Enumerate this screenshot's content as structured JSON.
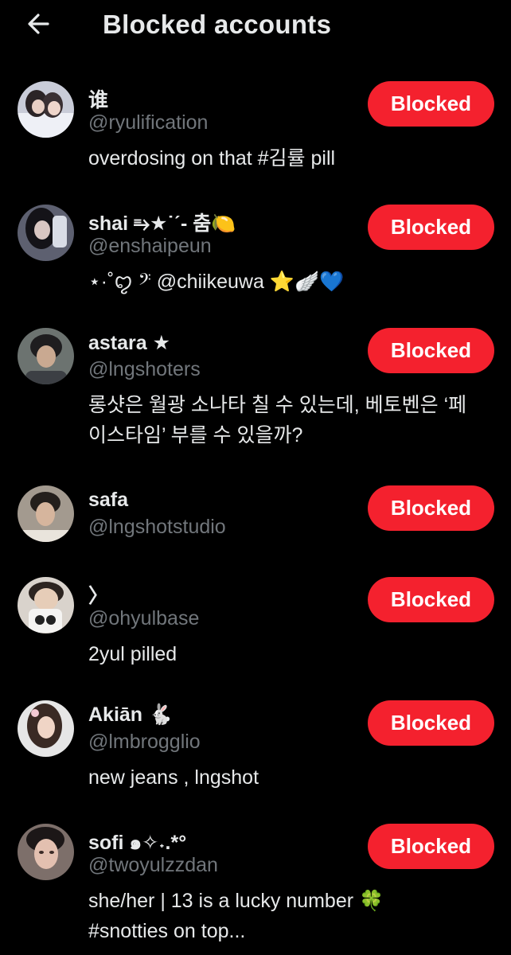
{
  "header": {
    "title": "Blocked accounts",
    "back_icon": "arrow-left-icon"
  },
  "colors": {
    "background": "#000000",
    "primary_text": "#e7e9ea",
    "secondary_text": "#71767b",
    "blocked_button": "#f4212e"
  },
  "accounts": [
    {
      "name": "谁",
      "handle": "@ryulification",
      "bio": [
        "overdosing on that #김률 pill"
      ],
      "button": "Blocked"
    },
    {
      "name": "shai ⥱★˙ˊ- 춤🍋",
      "handle": "@enshaipeun",
      "bio": [
        "⋆·˚ꨄ︎ 𝄢 @chiikeuwa ⭐🪽💙"
      ],
      "button": "Blocked"
    },
    {
      "name": "astara ★",
      "handle": "@lngshoters",
      "bio": [
        "롱샷은 월광 소나타 칠 수 있는데, 베토벤은 ‘페",
        "이스타임’ 부를 수 있을까?"
      ],
      "button": "Blocked"
    },
    {
      "name": "safa",
      "handle": "@lngshotstudio",
      "bio": [],
      "button": "Blocked"
    },
    {
      "name": "〉",
      "handle": "@ohyulbase",
      "bio": [
        "2yul pilled"
      ],
      "button": "Blocked"
    },
    {
      "name": "Akiān 🐇",
      "handle": "@lmbrogglio",
      "bio": [
        "new jeans ,  lngshot"
      ],
      "button": "Blocked"
    },
    {
      "name": "sofi ๑✧˖.*°",
      "handle": "@twoyulzzdan",
      "bio": [
        "she/her | 13 is a lucky number 🍀",
        "#snotties on top..."
      ],
      "button": "Blocked"
    }
  ]
}
